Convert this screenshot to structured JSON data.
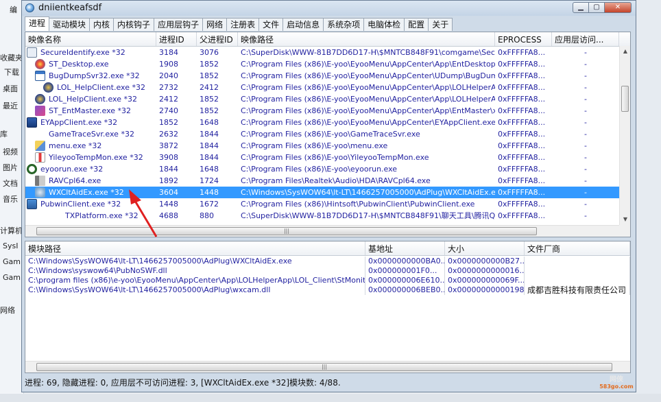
{
  "background": {
    "left_items": [
      "编",
      "收藏夹",
      "下载",
      "桌面",
      "最近",
      "库",
      "视频",
      "图片",
      "文档",
      "音乐",
      "计算机",
      "SysI",
      "Gam",
      "Gam",
      "网络"
    ]
  },
  "window": {
    "title": "dniientkeafsdf",
    "buttons": {
      "minimize": "▁",
      "maximize": "▢",
      "close": "✕"
    }
  },
  "tabs": [
    "进程",
    "驱动模块",
    "内核",
    "内核钩子",
    "应用层钩子",
    "网络",
    "注册表",
    "文件",
    "启动信息",
    "系统杂项",
    "电脑体检",
    "配置",
    "关于"
  ],
  "active_tab": "进程",
  "process_table": {
    "columns": [
      "映像名称",
      "进程ID",
      "父进程ID",
      "映像路径",
      "EPROCESS",
      "应用层访问..."
    ],
    "rows": [
      {
        "name": "SecureIdentify.exe *32",
        "pid": "3184",
        "ppid": "3076",
        "path": "C:\\SuperDisk\\WWW-81B7DD6D17-H\\$MNTCB848F91\\comgame\\SecureId...",
        "eprocess": "0xFFFFFA8...",
        "access": "-",
        "icon": "shield-doc-icon",
        "indent": 0
      },
      {
        "name": "ST_Desktop.exe",
        "pid": "1908",
        "ppid": "1852",
        "path": "C:\\Program Files (x86)\\E-yoo\\EyooMenu\\AppCenter\\App\\EntDesktop\\x6...",
        "eprocess": "0xFFFFFA8...",
        "access": "-",
        "icon": "desktop-ball-icon",
        "indent": 1
      },
      {
        "name": "BugDumpSvr32.exe *32",
        "pid": "2040",
        "ppid": "1852",
        "path": "C:\\Program Files (x86)\\E-yoo\\EyooMenu\\AppCenter\\UDump\\BugDumpSv...",
        "eprocess": "0xFFFFFA8...",
        "access": "-",
        "icon": "window-icon",
        "indent": 1
      },
      {
        "name": "LOL_HelpClient.exe *32",
        "pid": "2732",
        "ppid": "2412",
        "path": "C:\\Program Files (x86)\\E-yoo\\EyooMenu\\AppCenter\\App\\LOLHelperApp\\...",
        "eprocess": "0xFFFFFA8...",
        "access": "-",
        "icon": "lol-icon",
        "indent": 2
      },
      {
        "name": "LOL_HelpClient.exe *32",
        "pid": "2412",
        "ppid": "1852",
        "path": "C:\\Program Files (x86)\\E-yoo\\EyooMenu\\AppCenter\\App\\LOLHelperApp\\...",
        "eprocess": "0xFFFFFA8...",
        "access": "-",
        "icon": "lol-icon",
        "indent": 1
      },
      {
        "name": "ST_EntMaster.exe *32",
        "pid": "2740",
        "ppid": "1852",
        "path": "C:\\Program Files (x86)\\E-yoo\\EyooMenu\\AppCenter\\App\\EntMaster\\x86\\...",
        "eprocess": "0xFFFFFA8...",
        "access": "-",
        "icon": "entmaster-icon",
        "indent": 1
      },
      {
        "name": "EYAppClient.exe *32",
        "pid": "1852",
        "ppid": "1648",
        "path": "C:\\Program Files (x86)\\E-yoo\\EyooMenu\\AppCenter\\EYAppClient.exe",
        "eprocess": "0xFFFFFA8...",
        "access": "-",
        "icon": "eyapp-icon",
        "indent": 0
      },
      {
        "name": "GameTraceSvr.exe *32",
        "pid": "2632",
        "ppid": "1844",
        "path": "C:\\Program Files (x86)\\E-yoo\\GameTraceSvr.exe",
        "eprocess": "0xFFFFFA8...",
        "access": "-",
        "icon": "blank-icon",
        "indent": 1
      },
      {
        "name": "menu.exe *32",
        "pid": "3872",
        "ppid": "1844",
        "path": "C:\\Program Files (x86)\\E-yoo\\menu.exe",
        "eprocess": "0xFFFFFA8...",
        "access": "-",
        "icon": "menu-icon",
        "indent": 1
      },
      {
        "name": "YileyooTempMon.exe *32",
        "pid": "3908",
        "ppid": "1844",
        "path": "C:\\Program Files (x86)\\E-yoo\\YileyooTempMon.exe",
        "eprocess": "0xFFFFFA8...",
        "access": "-",
        "icon": "thermometer-icon",
        "indent": 1
      },
      {
        "name": "eyoorun.exe *32",
        "pid": "1844",
        "ppid": "1648",
        "path": "C:\\Program Files (x86)\\E-yoo\\eyoorun.exe",
        "eprocess": "0xFFFFFA8...",
        "access": "-",
        "icon": "power-icon",
        "indent": 0
      },
      {
        "name": "RAVCpl64.exe",
        "pid": "1892",
        "ppid": "1724",
        "path": "C:\\Program Files\\Realtek\\Audio\\HDA\\RAVCpl64.exe",
        "eprocess": "0xFFFFFA8...",
        "access": "-",
        "icon": "speaker-icon",
        "indent": 1
      },
      {
        "name": "WXCltAidEx.exe *32",
        "pid": "3604",
        "ppid": "1448",
        "path": "C:\\Windows\\SysWOW64\\lt-LT\\1466257005000\\AdPlug\\WXCltAidEx.exe",
        "eprocess": "0xFFFFFA8...",
        "access": "-",
        "icon": "gear-app-icon",
        "indent": 1,
        "selected": true
      },
      {
        "name": "PubwinClient.exe *32",
        "pid": "1448",
        "ppid": "1672",
        "path": "C:\\Program Files (x86)\\Hintsoft\\PubwinClient\\PubwinClient.exe",
        "eprocess": "0xFFFFFA8...",
        "access": "-",
        "icon": "monitor-icon",
        "indent": 0
      },
      {
        "name": "TXPlatform.exe *32",
        "pid": "4688",
        "ppid": "880",
        "path": "C:\\SuperDisk\\WWW-81B7DD6D17-H\\$MNTCB848F91\\聊天工具\\腾讯QQ...",
        "eprocess": "0xFFFFFA8...",
        "access": "-",
        "icon": "blank-icon",
        "indent": 3
      }
    ]
  },
  "module_table": {
    "columns": [
      "模块路径",
      "基地址",
      "大小",
      "文件厂商"
    ],
    "rows": [
      {
        "path": "C:\\Windows\\SysWOW64\\lt-LT\\1466257005000\\AdPlug\\WXCltAidEx.exe",
        "base": "0x0000000000BA0...",
        "size": "0x0000000000B27...",
        "vendor": ""
      },
      {
        "path": "C:\\Windows\\syswow64\\PubNoSWF.dll",
        "base": "0x000000001F0...",
        "size": "0x0000000000016...",
        "vendor": ""
      },
      {
        "path": "C:\\program files (x86)\\e-yoo\\EyooMenu\\AppCenter\\App\\LOLHelperApp\\LOL_Client\\StMonitor.dll",
        "base": "0x000000006E610...",
        "size": "0x000000000069F...",
        "vendor": ""
      },
      {
        "path": "C:\\Windows\\SysWOW64\\lt-LT\\1466257005000\\AdPlug\\wxcam.dll",
        "base": "0x000000006BEB0...",
        "size": "0x00000000000198...",
        "vendor": "成都吉胜科技有限责任公司"
      }
    ]
  },
  "status_bar": "进程: 69, 隐藏进程: 0, 应用层不可访问进程: 3, [WXCltAidEx.exe *32]模块数: 4/88.",
  "watermark": {
    "text": "网侠",
    "url": "583go.com"
  },
  "colors": {
    "selection": "#3399ff",
    "row_text": "#1f1f9f",
    "annotation": "#e02020",
    "watermark_url": "#e36c1f"
  }
}
